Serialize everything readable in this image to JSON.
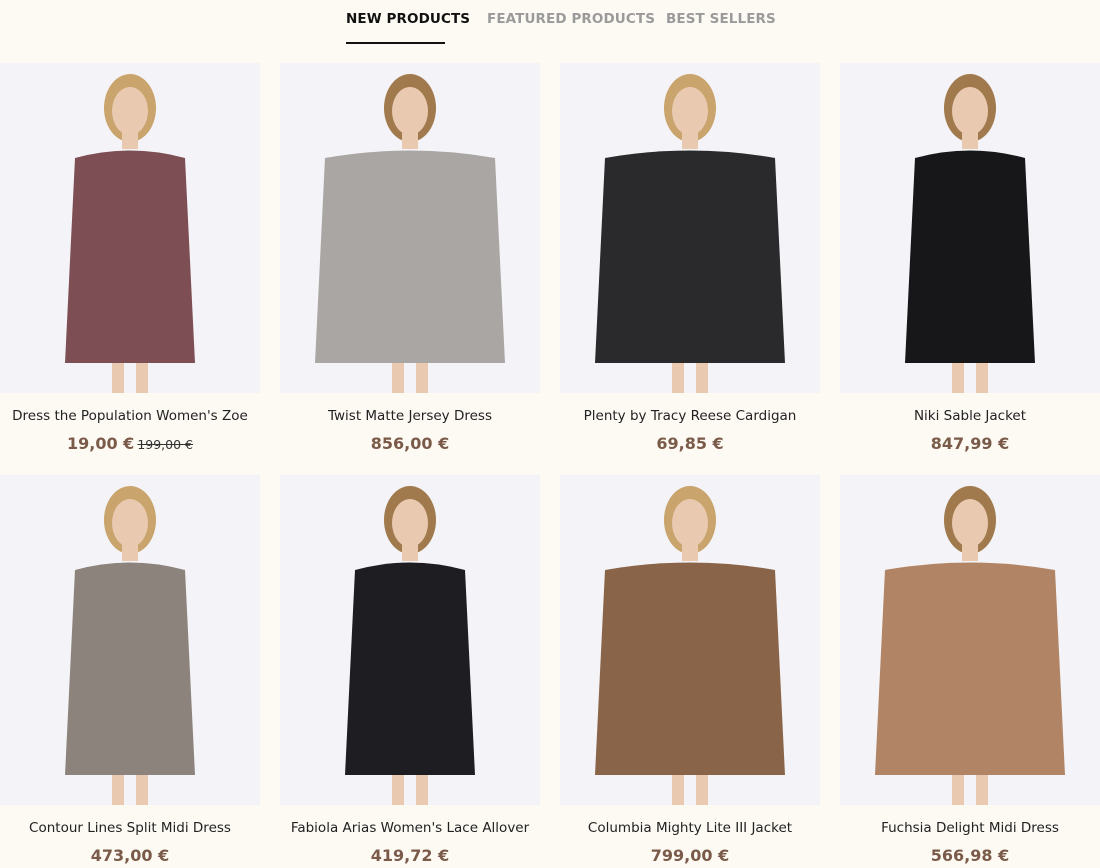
{
  "tabs": [
    {
      "label": "NEW PRODUCTS",
      "active": true
    },
    {
      "label": "FEATURED PRODUCTS",
      "active": false
    },
    {
      "label": "BEST SELLERS",
      "active": false
    }
  ],
  "products": [
    {
      "name": "Dress the Population Women's Zoe",
      "price": "19,00 €",
      "old_price": "199,00 €",
      "garment_color": "#7d4f55"
    },
    {
      "name": "Twist Matte Jersey Dress",
      "price": "856,00 €",
      "garment_color": "#a9a6a3"
    },
    {
      "name": "Plenty by Tracy Reese Cardigan",
      "price": "69,85 €",
      "garment_color": "#2a2a2c"
    },
    {
      "name": "Niki Sable Jacket",
      "price": "847,99 €",
      "garment_color": "#17171a"
    },
    {
      "name": "Contour Lines Split Midi Dress",
      "price": "473,00 €",
      "garment_color": "#8c847c"
    },
    {
      "name": "Fabiola Arias Women's Lace Allover",
      "price": "419,72 €",
      "garment_color": "#1e1e22"
    },
    {
      "name": "Columbia Mighty Lite III Jacket",
      "price": "799,00 €",
      "garment_color": "#8a6448"
    },
    {
      "name": "Fuchsia Delight Midi Dress",
      "price": "566,98 €",
      "garment_color": "#b08464"
    }
  ],
  "colors": {
    "background": "#fdfaf4",
    "price": "#7a5a48",
    "image_bg": "#f4f3f7"
  }
}
